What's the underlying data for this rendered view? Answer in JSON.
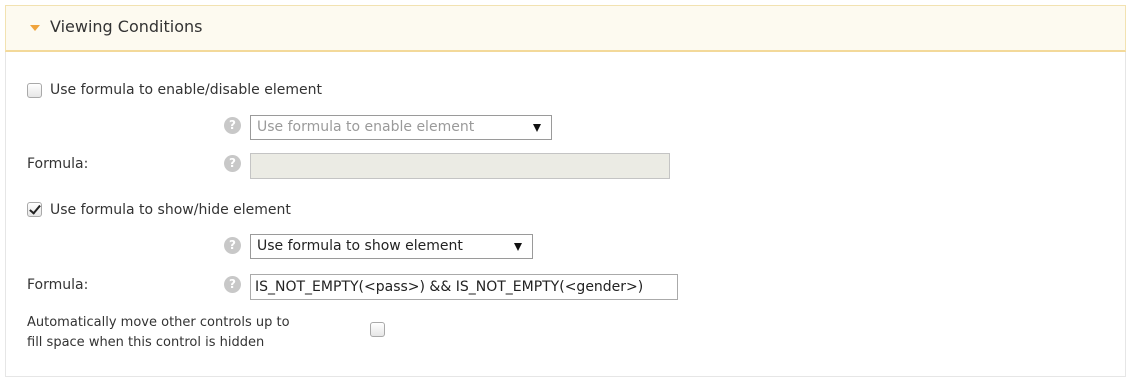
{
  "header": {
    "title": "Viewing Conditions"
  },
  "enable_section": {
    "checkbox_label": "Use formula to enable/disable element",
    "checked": false,
    "select_value": "Use formula to enable element",
    "formula_label": "Formula:",
    "formula_value": ""
  },
  "show_section": {
    "checkbox_label": "Use formula to show/hide element",
    "checked": true,
    "select_value": "Use formula to show element",
    "formula_label": "Formula:",
    "formula_value": "IS_NOT_EMPTY(<pass>) && IS_NOT_EMPTY(<gender>)"
  },
  "auto_move": {
    "label_line1": "Automatically move other controls up to",
    "label_line2": "fill space when this control is hidden",
    "checked": false
  },
  "help_icon_glyph": "?",
  "colors": {
    "caret": "#f0a43c",
    "header_bg": "#fdfaf0",
    "header_border": "#f3d99a"
  }
}
